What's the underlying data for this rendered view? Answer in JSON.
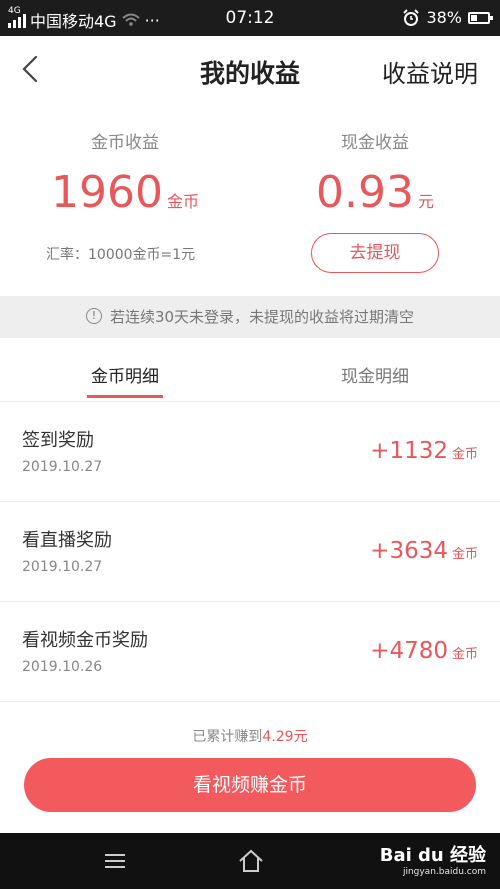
{
  "status_bar": {
    "network_tag": "4G",
    "carrier": "中国移动4G",
    "dots": "···",
    "time": "07:12",
    "battery": "38%",
    "battery_level": 0.38
  },
  "header": {
    "title": "我的收益",
    "explain_label": "收益说明"
  },
  "summary": {
    "coin": {
      "label": "金币收益",
      "value": "1960",
      "unit": "金币"
    },
    "cash": {
      "label": "现金收益",
      "value": "0.93",
      "unit": "元"
    },
    "rate": "汇率：10000金币=1元",
    "withdraw_label": "去提现"
  },
  "notice": {
    "icon_glyph": "!",
    "text": "若连续30天未登录，未提现的收益将过期清空"
  },
  "tabs": [
    {
      "label": "金币明细",
      "active": true
    },
    {
      "label": "现金明细",
      "active": false
    }
  ],
  "records": [
    {
      "name": "签到奖励",
      "date": "2019.10.27",
      "amount": "+1132",
      "unit": "金币"
    },
    {
      "name": "看直播奖励",
      "date": "2019.10.27",
      "amount": "+3634",
      "unit": "金币"
    },
    {
      "name": "看视频金币奖励",
      "date": "2019.10.26",
      "amount": "+4780",
      "unit": "金币"
    }
  ],
  "total": {
    "prefix": "已累计赚到",
    "amount": "4.29元"
  },
  "cta_label": "看视频赚金币",
  "watermark": {
    "brand": "Bai du 经验",
    "url": "jingyan.baidu.com"
  },
  "colors": {
    "accent": "#e8575a",
    "cta": "#f35a5e"
  }
}
